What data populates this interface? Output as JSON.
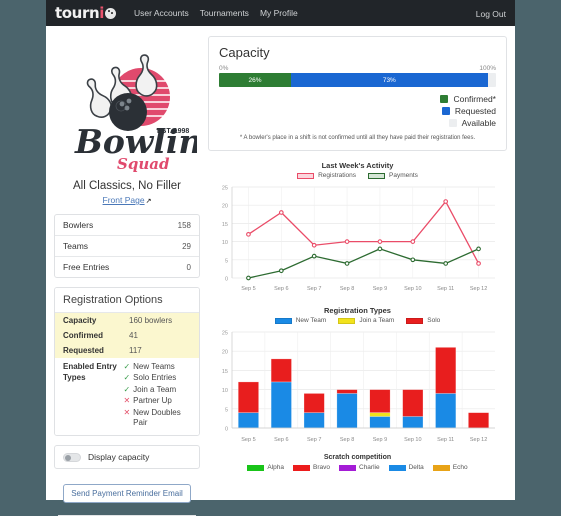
{
  "navbar": {
    "brand_text": "tourn",
    "brand_i": "i",
    "links": [
      {
        "label": "User Accounts"
      },
      {
        "label": "Tournaments"
      },
      {
        "label": "My Profile"
      }
    ],
    "logout": "Log Out"
  },
  "logo": {
    "wordmark": "Bowling",
    "subtext": "Squad",
    "established": "EST. 1998",
    "alt": "bowling-squad-logo"
  },
  "sidebar": {
    "tournament_name": "All Classics, No Filler",
    "front_page_link": "Front Page",
    "external_icon": "↗",
    "stats": [
      {
        "label": "Bowlers",
        "value": "158"
      },
      {
        "label": "Teams",
        "value": "29"
      },
      {
        "label": "Free Entries",
        "value": "0"
      }
    ],
    "registration_options": {
      "heading": "Registration Options",
      "rows": [
        {
          "key": "Capacity",
          "value": "160 bowlers"
        },
        {
          "key": "Confirmed",
          "value": "41"
        },
        {
          "key": "Requested",
          "value": "117"
        }
      ],
      "entry_types_label": "Enabled Entry Types",
      "entry_types": [
        {
          "label": "New Teams",
          "enabled": true,
          "mark": "✓"
        },
        {
          "label": "Solo Entries",
          "enabled": true,
          "mark": "✓"
        },
        {
          "label": "Join a Team",
          "enabled": true,
          "mark": "✓"
        },
        {
          "label": "Partner Up",
          "enabled": false,
          "mark": "✕"
        },
        {
          "label": "New Doubles Pair",
          "enabled": false,
          "mark": "✕"
        }
      ]
    },
    "display_capacity_toggle": {
      "label": "Display capacity",
      "state": "off"
    },
    "send_reminder_button": "Send Payment Reminder Email"
  },
  "capacity_panel": {
    "title": "Capacity",
    "scale_min": "0%",
    "scale_max": "100%",
    "segments": [
      {
        "label": "26%",
        "percent": 26,
        "color": "#2e7d34"
      },
      {
        "label": "73%",
        "percent": 73,
        "color": "#1a67d2"
      }
    ],
    "legend": [
      {
        "label": "Confirmed*",
        "color": "#2e7d34"
      },
      {
        "label": "Requested",
        "color": "#1a67d2"
      },
      {
        "label": "Available",
        "color": "#eceef0"
      }
    ],
    "footnote": "* A bowler's place in a shift is not confirmed until all they have paid their registration fees."
  },
  "chart_data": [
    {
      "type": "line",
      "title": "Last Week's Activity",
      "categories": [
        "Sep 5",
        "Sep 6",
        "Sep 7",
        "Sep 8",
        "Sep 9",
        "Sep 10",
        "Sep 11",
        "Sep 12"
      ],
      "series": [
        {
          "name": "Registrations",
          "color": "#ea4c68",
          "values": [
            12,
            18,
            9,
            10,
            10,
            10,
            21,
            4
          ]
        },
        {
          "name": "Payments",
          "color": "#2d6b31",
          "values": [
            0,
            2,
            6,
            4,
            8,
            5,
            4,
            8
          ]
        }
      ],
      "ylim": [
        0,
        25
      ],
      "yticks": [
        0,
        5,
        10,
        15,
        20,
        25
      ],
      "xlabel": "",
      "ylabel": "",
      "grid": true,
      "legend_position": "top"
    },
    {
      "type": "bar",
      "title": "Registration Types",
      "stacked": true,
      "categories": [
        "Sep 5",
        "Sep 6",
        "Sep 7",
        "Sep 8",
        "Sep 9",
        "Sep 10",
        "Sep 11",
        "Sep 12"
      ],
      "series": [
        {
          "name": "New Team",
          "color": "#1a8ae5",
          "values": [
            4,
            12,
            4,
            9,
            3,
            3,
            9,
            0
          ]
        },
        {
          "name": "Join a Team",
          "color": "#f2e21c",
          "values": [
            0,
            0,
            0,
            0,
            1,
            0,
            0,
            0
          ]
        },
        {
          "name": "Solo",
          "color": "#e81e1e",
          "values": [
            8,
            6,
            5,
            1,
            6,
            7,
            12,
            4
          ]
        }
      ],
      "ylim": [
        0,
        25
      ],
      "yticks": [
        0,
        5,
        10,
        15,
        20,
        25
      ],
      "grid": true,
      "legend_position": "top"
    },
    {
      "type": "bar",
      "title": "Scratch competition",
      "categories": [],
      "series": [
        {
          "name": "Alpha",
          "color": "#19c419",
          "values": []
        },
        {
          "name": "Bravo",
          "color": "#ec1c1c",
          "values": []
        },
        {
          "name": "Charlie",
          "color": "#a41cd6",
          "values": []
        },
        {
          "name": "Delta",
          "color": "#1a8ae5",
          "values": []
        },
        {
          "name": "Echo",
          "color": "#e8a317",
          "values": []
        }
      ],
      "legend_position": "top"
    }
  ]
}
